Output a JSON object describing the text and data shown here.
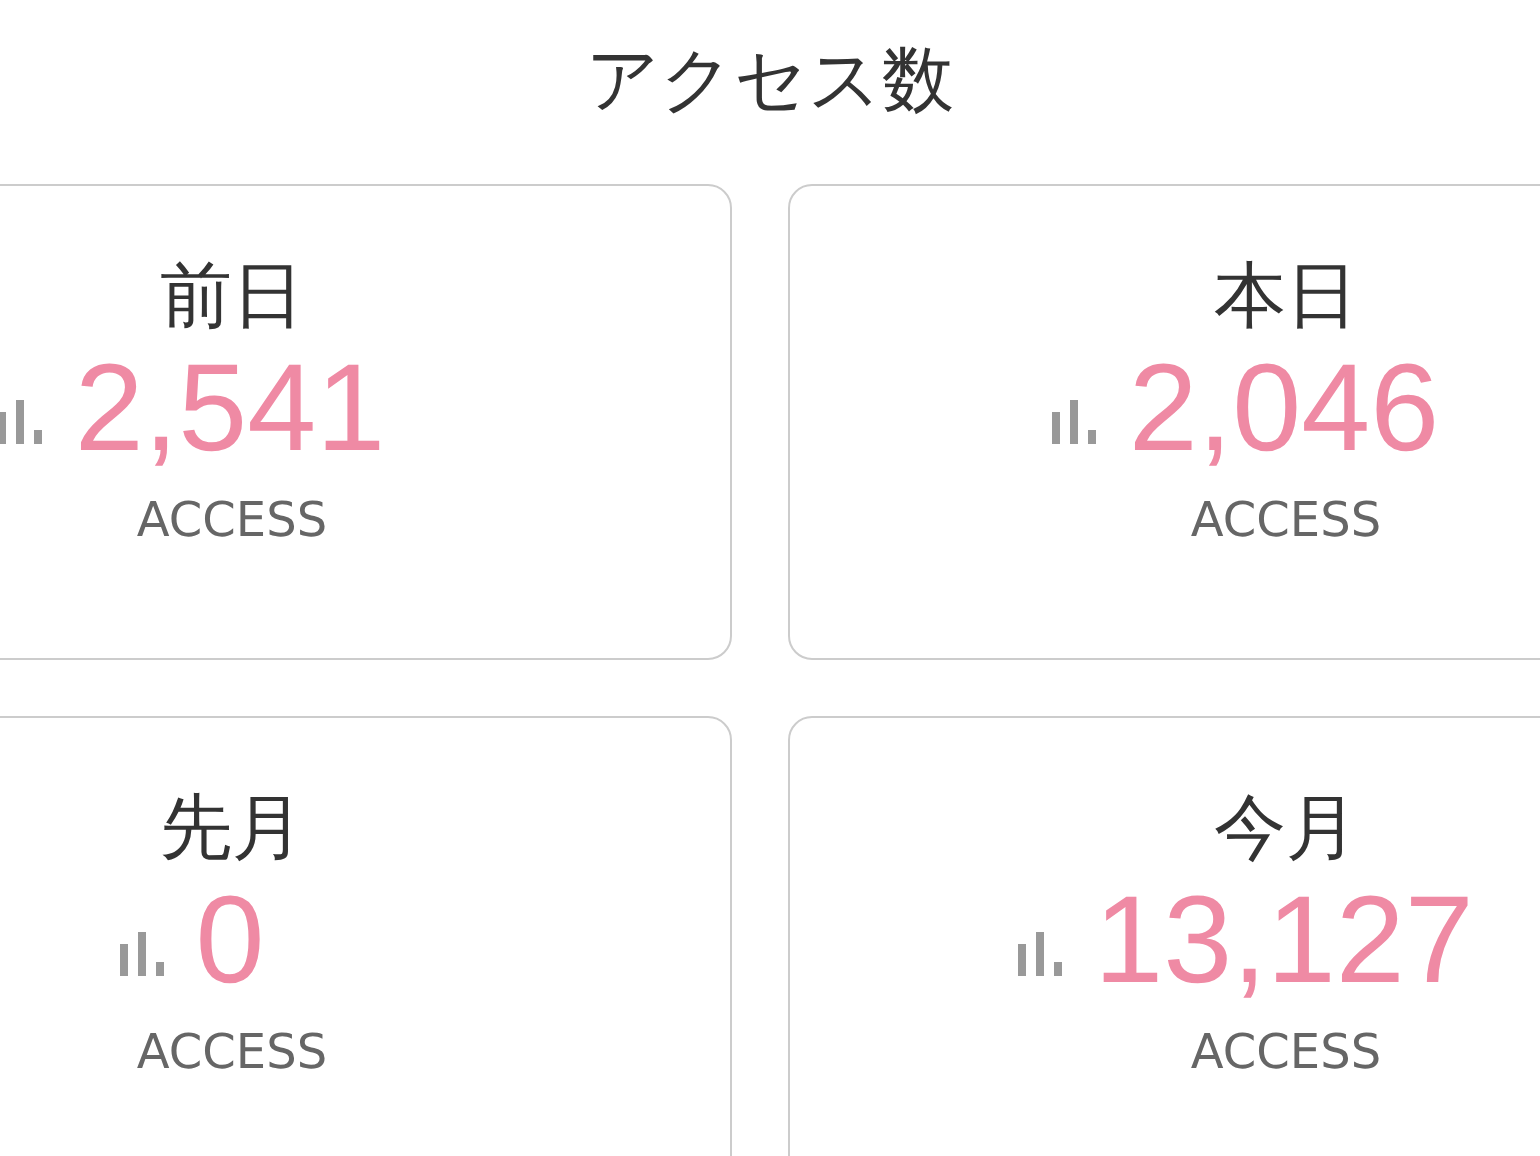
{
  "title": "アクセス数",
  "cards": [
    {
      "label": "前日",
      "value": "2,541",
      "unit": "ACCESS"
    },
    {
      "label": "本日",
      "value": "2,046",
      "unit": "ACCESS"
    },
    {
      "label": "先月",
      "value": "0",
      "unit": "ACCESS"
    },
    {
      "label": "今月",
      "value": "13,127",
      "unit": "ACCESS"
    }
  ]
}
